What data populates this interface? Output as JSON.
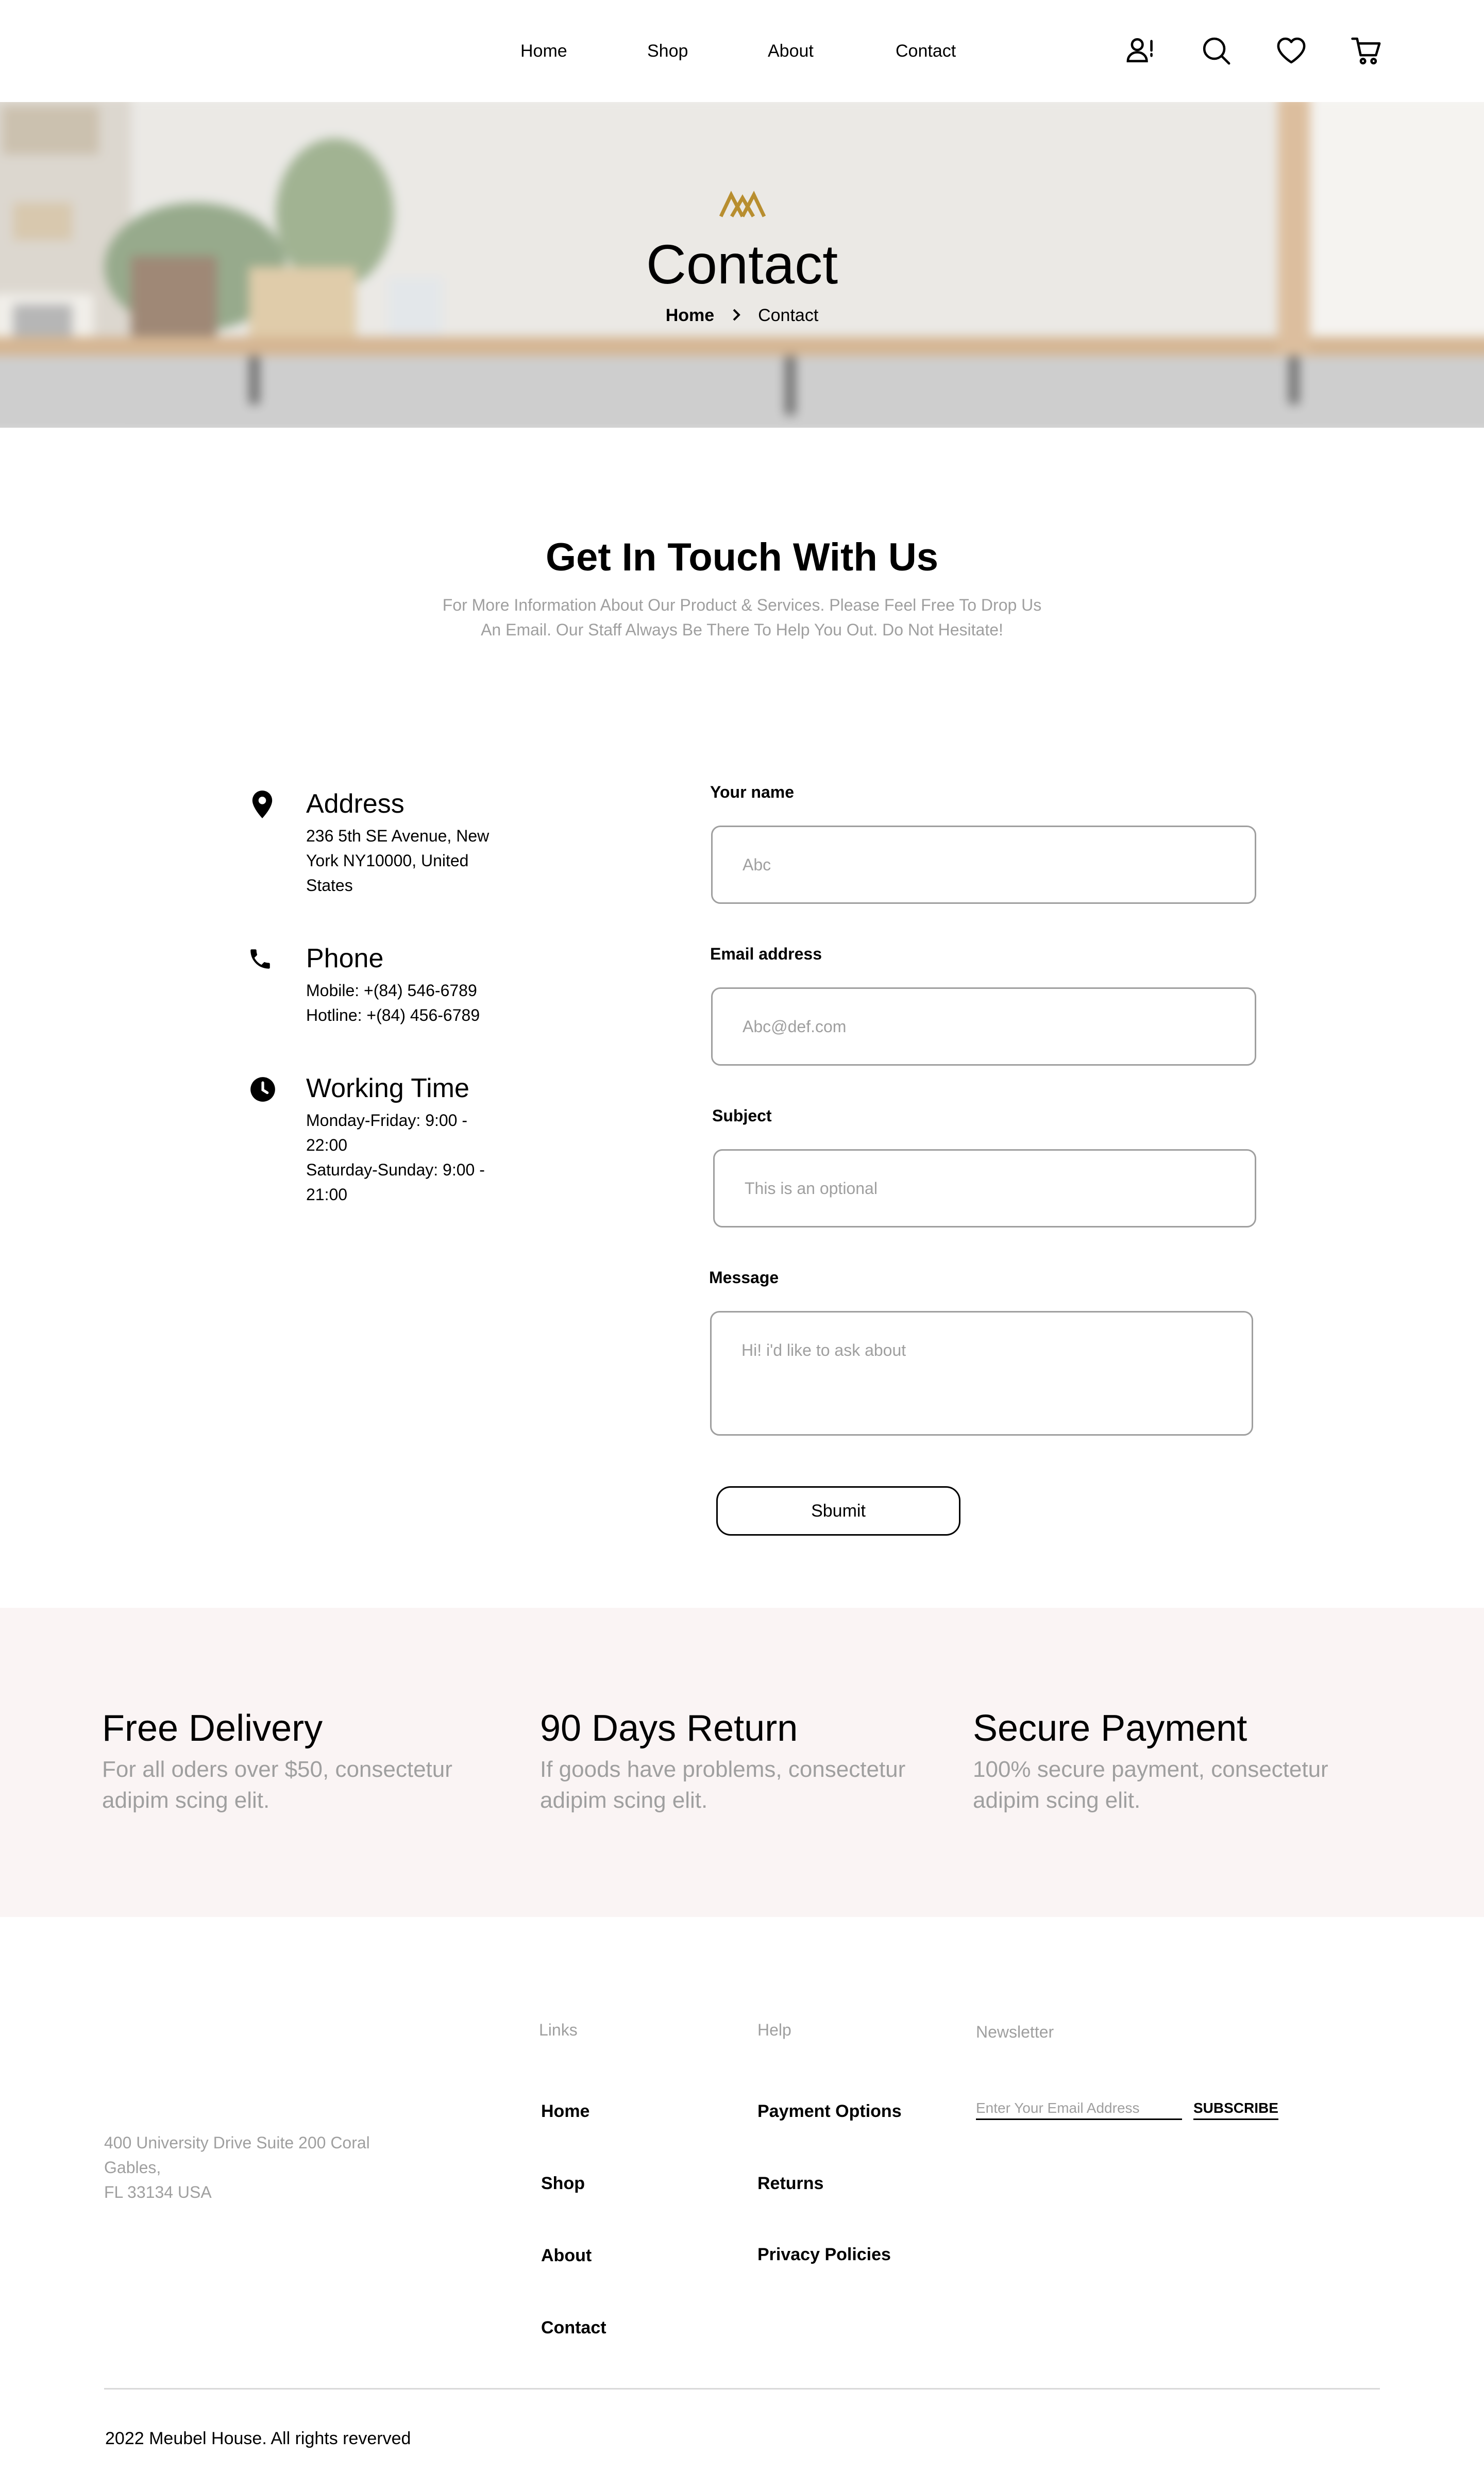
{
  "nav": {
    "items": [
      "Home",
      "Shop",
      "About",
      "Contact"
    ],
    "icons": [
      "account-alert-icon",
      "search-icon",
      "heart-icon",
      "cart-icon"
    ]
  },
  "banner": {
    "title": "Contact",
    "breadcrumb_home": "Home",
    "breadcrumb_current": "Contact",
    "logo_color": "#b88e2f"
  },
  "intro": {
    "title": "Get In Touch With Us",
    "text_line1": "For More Information About Our Product & Services. Please Feel Free To Drop Us",
    "text_line2": "An Email. Our Staff Always Be There To Help You Out. Do Not Hesitate!"
  },
  "info": {
    "address": {
      "title": "Address",
      "lines": [
        "236 5th SE Avenue, New",
        "York NY10000, United",
        "States"
      ]
    },
    "phone": {
      "title": "Phone",
      "lines": [
        "Mobile: +(84) 546-6789",
        "Hotline: +(84) 456-6789"
      ]
    },
    "working": {
      "title": "Working Time",
      "lines": [
        "Monday-Friday: 9:00 -",
        "22:00",
        "Saturday-Sunday: 9:00 -",
        "21:00"
      ]
    }
  },
  "form": {
    "name_label": "Your name",
    "name_placeholder": "Abc",
    "email_label": "Email address",
    "email_placeholder": "Abc@def.com",
    "subject_label": "Subject",
    "subject_placeholder": "This is an optional",
    "message_label": "Message",
    "message_placeholder": "Hi! i'd like to ask about",
    "submit_label": "Sbumit"
  },
  "features": [
    {
      "title": "Free Delivery",
      "desc_line1": "For all oders over $50, consectetur",
      "desc_line2": "adipim scing elit."
    },
    {
      "title": "90 Days Return",
      "desc_line1": "If goods have problems, consectetur",
      "desc_line2": "adipim scing elit."
    },
    {
      "title": "Secure Payment",
      "desc_line1": "100% secure payment, consectetur",
      "desc_line2": "adipim scing elit."
    }
  ],
  "footer": {
    "address_lines": [
      "400 University Drive Suite 200 Coral",
      "Gables,",
      "FL 33134 USA"
    ],
    "links_heading": "Links",
    "links": [
      "Home",
      "Shop",
      "About",
      "Contact"
    ],
    "help_heading": "Help",
    "help": [
      "Payment Options",
      "Returns",
      "Privacy Policies"
    ],
    "newsletter_heading": "Newsletter",
    "newsletter_placeholder": "Enter Your Email Address",
    "subscribe_label": "SUBSCRIBE",
    "copyright": "2022 Meubel House. All rights reverved"
  },
  "colors": {
    "accent": "#b88e2f",
    "muted_text": "#9f9f9f",
    "feature_band": "#faf4f4"
  }
}
